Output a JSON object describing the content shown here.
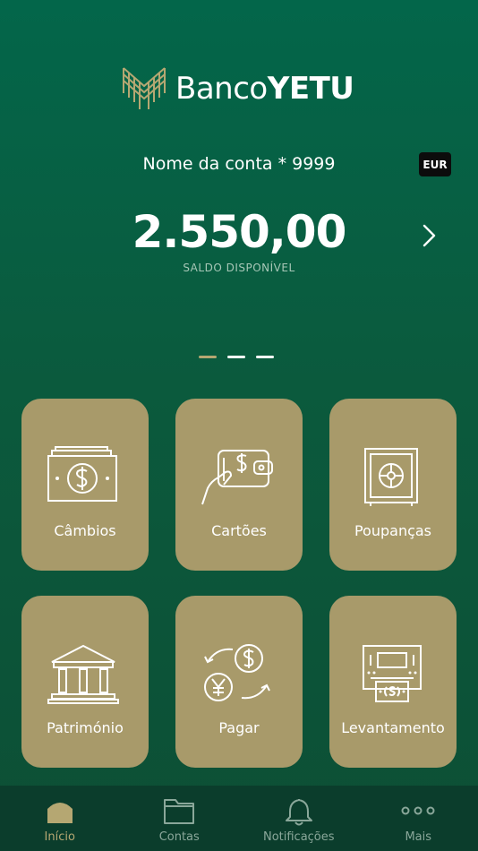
{
  "brand": {
    "name_light": "Banco",
    "name_bold": "YETU"
  },
  "account": {
    "name": "Nome da conta * 9999",
    "currency": "EUR",
    "balance": "2.550,00",
    "balance_label": "SALDO DISPONÍVEL"
  },
  "pager": {
    "pages": 3,
    "active": 0
  },
  "tiles": [
    {
      "label": "Câmbios",
      "icon": "banknote-icon"
    },
    {
      "label": "Cartões",
      "icon": "wallet-card-icon"
    },
    {
      "label": "Poupanças",
      "icon": "safe-icon"
    },
    {
      "label": "Património",
      "icon": "bank-building-icon"
    },
    {
      "label": "Pagar",
      "icon": "currency-exchange-icon"
    },
    {
      "label": "Levantamento",
      "icon": "atm-withdrawal-icon"
    }
  ],
  "tabs": [
    {
      "label": "Início",
      "icon": "home-icon",
      "active": true
    },
    {
      "label": "Contas",
      "icon": "folder-icon",
      "active": false
    },
    {
      "label": "Notificações",
      "icon": "bell-icon",
      "active": false
    },
    {
      "label": "Mais",
      "icon": "more-dots-icon",
      "active": false
    }
  ],
  "colors": {
    "background_top": "#03664a",
    "background_bottom": "#0d4f35",
    "tile": "#a89a6a",
    "accent_gold": "#b5a772",
    "tabbar": "#0b3d2c"
  }
}
